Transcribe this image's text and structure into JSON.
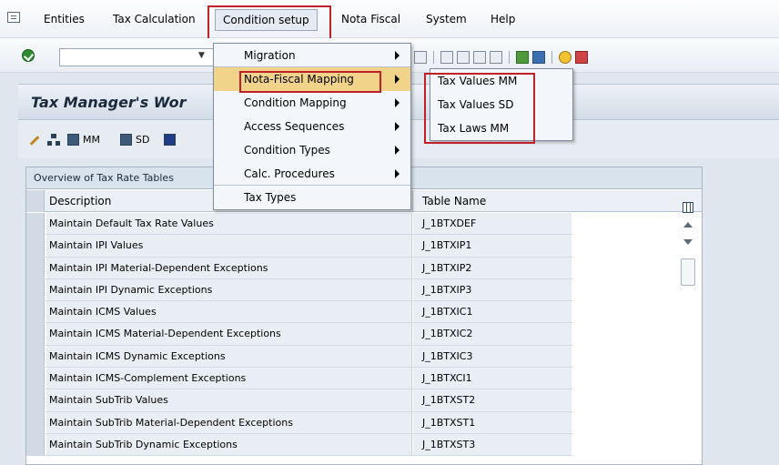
{
  "menubar": {
    "items": [
      "Entities",
      "Tax Calculation",
      "Condition setup",
      "Nota Fiscal",
      "System",
      "Help"
    ]
  },
  "page": {
    "title": "Tax Manager's Wor"
  },
  "app_toolbar": {
    "mm_label": "MM",
    "sd_label": "SD"
  },
  "table": {
    "caption": "Overview of Tax Rate Tables",
    "col_description": "Description",
    "col_table_name": "Table Name",
    "rows": [
      {
        "desc": "Maintain Default Tax Rate Values",
        "table": "J_1BTXDEF"
      },
      {
        "desc": "Maintain IPI Values",
        "table": "J_1BTXIP1"
      },
      {
        "desc": "Maintain IPI Material-Dependent Exceptions",
        "table": "J_1BTXIP2"
      },
      {
        "desc": "Maintain IPI Dynamic Exceptions",
        "table": "J_1BTXIP3"
      },
      {
        "desc": "Maintain ICMS Values",
        "table": "J_1BTXIC1"
      },
      {
        "desc": "Maintain ICMS Material-Dependent Exceptions",
        "table": "J_1BTXIC2"
      },
      {
        "desc": "Maintain ICMS Dynamic Exceptions",
        "table": "J_1BTXIC3"
      },
      {
        "desc": "Maintain ICMS-Complement Exceptions",
        "table": "J_1BTXCI1"
      },
      {
        "desc": "Maintain SubTrib Values",
        "table": "J_1BTXST2"
      },
      {
        "desc": "Maintain SubTrib Material-Dependent Exceptions",
        "table": "J_1BTXST1"
      },
      {
        "desc": "Maintain SubTrib Dynamic Exceptions",
        "table": "J_1BTXST3"
      }
    ]
  },
  "condition_menu": {
    "items": [
      {
        "label": "Migration",
        "submenu": true
      },
      {
        "label": "Nota-Fiscal Mapping",
        "submenu": true
      },
      {
        "label": "Condition Mapping",
        "submenu": true
      },
      {
        "label": "Access Sequences",
        "submenu": true
      },
      {
        "label": "Condition Types",
        "submenu": true
      },
      {
        "label": "Calc. Procedures",
        "submenu": true
      },
      {
        "label": "Tax Types",
        "submenu": false
      }
    ]
  },
  "nf_mapping_submenu": {
    "items": [
      "Tax Values MM",
      "Tax Values SD",
      "Tax Laws MM"
    ]
  },
  "colors": {
    "highlight_border": "#c0202a",
    "menu_hover": "#f2d38a"
  }
}
